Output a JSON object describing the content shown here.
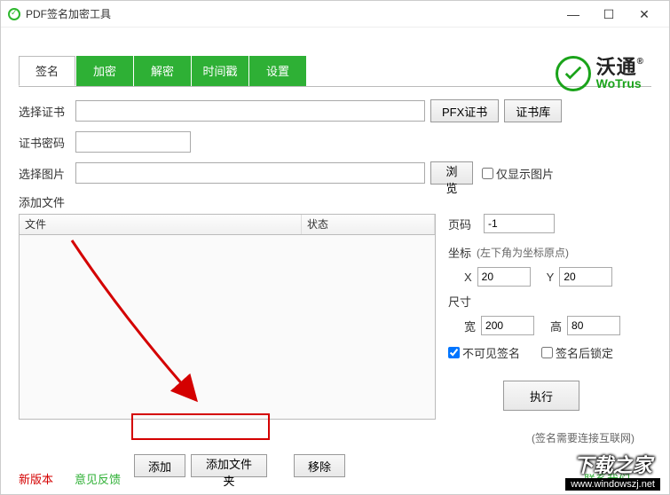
{
  "window": {
    "title": "PDF签名加密工具"
  },
  "logo": {
    "cn": "沃通",
    "en": "WoTrus"
  },
  "tabs": [
    "签名",
    "加密",
    "解密",
    "时间戳",
    "设置"
  ],
  "form": {
    "cert_label": "选择证书",
    "pfx_btn": "PFX证书",
    "certstore_btn": "证书库",
    "pwd_label": "证书密码",
    "img_label": "选择图片",
    "browse_btn": "浏览",
    "imgonly_label": "仅显示图片",
    "addfile_label": "添加文件"
  },
  "table": {
    "col_file": "文件",
    "col_status": "状态"
  },
  "side": {
    "page_label": "页码",
    "page_val": "-1",
    "coord_label": "坐标",
    "coord_hint": "(左下角为坐标原点)",
    "x_label": "X",
    "x_val": "20",
    "y_label": "Y",
    "y_val": "20",
    "size_label": "尺寸",
    "w_label": "宽",
    "w_val": "200",
    "h_label": "高",
    "h_val": "80",
    "invisible_label": "不可见签名",
    "lock_label": "签名后锁定",
    "exec_btn": "执行",
    "net_hint": "(签名需要连接互联网)"
  },
  "buttons": {
    "add": "添加",
    "add_folder": "添加文件夹",
    "remove": "移除"
  },
  "footer": {
    "newver": "新版本",
    "feedback": "意见反馈",
    "contact": "联系我们"
  },
  "watermark": {
    "line1": "下载之家",
    "line2": "www.windowszj.net"
  }
}
